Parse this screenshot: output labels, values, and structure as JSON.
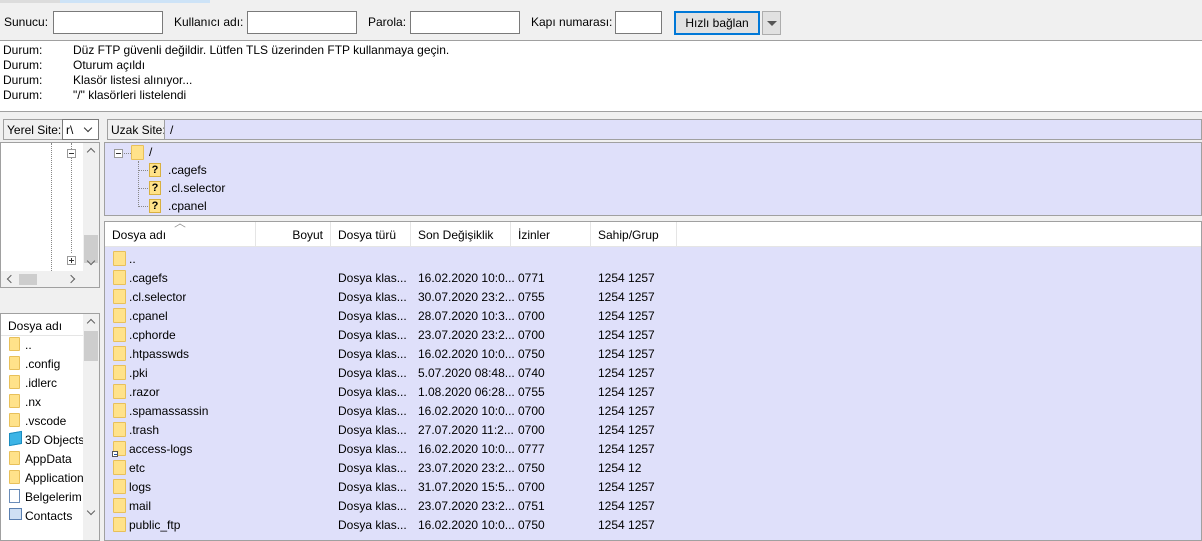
{
  "quickconnect": {
    "host_label": "Sunucu:",
    "host_value": "",
    "user_label": "Kullanıcı adı:",
    "user_value": "",
    "pass_label": "Parola:",
    "pass_value": "",
    "port_label": "Kapı numarası:",
    "port_value": "",
    "connect_label": "Hızlı bağlan"
  },
  "log": [
    {
      "key": "Durum:",
      "msg": "Düz FTP güvenli değildir. Lütfen TLS üzerinden FTP kullanmaya geçin."
    },
    {
      "key": "Durum:",
      "msg": "Oturum açıldı"
    },
    {
      "key": "Durum:",
      "msg": "Klasör listesi alınıyor..."
    },
    {
      "key": "Durum:",
      "msg": "\"/\" klasörleri listelendi"
    }
  ],
  "local": {
    "site_label": "Yerel Site:",
    "site_value": "r\\",
    "list_header": "Dosya adı",
    "items": [
      {
        "name": "..",
        "icon": "folder-icon"
      },
      {
        "name": ".config",
        "icon": "folder-icon"
      },
      {
        "name": ".idlerc",
        "icon": "folder-icon"
      },
      {
        "name": ".nx",
        "icon": "folder-icon"
      },
      {
        "name": ".vscode",
        "icon": "folder-icon"
      },
      {
        "name": "3D Objects",
        "icon": "3d-objects-icon"
      },
      {
        "name": "AppData",
        "icon": "folder-icon"
      },
      {
        "name": "Application",
        "icon": "folder-icon"
      },
      {
        "name": "Belgelerim",
        "icon": "documents-icon"
      },
      {
        "name": "Contacts",
        "icon": "contacts-icon"
      }
    ]
  },
  "remote": {
    "site_label": "Uzak Site:",
    "site_value": "/",
    "tree": {
      "root": "/",
      "children": [
        ".cagefs",
        ".cl.selector",
        ".cpanel"
      ]
    },
    "columns": [
      "Dosya adı",
      "Boyut",
      "Dosya türü",
      "Son Değişiklik",
      "İzinler",
      "Sahip/Grup"
    ],
    "rows": [
      {
        "name": "..",
        "size": "",
        "type": "",
        "modified": "",
        "perms": "",
        "owner": "",
        "icon": "folder-icon"
      },
      {
        "name": ".cagefs",
        "size": "",
        "type": "Dosya klas...",
        "modified": "16.02.2020 10:0...",
        "perms": "0771",
        "owner": "1254 1257",
        "icon": "folder-icon"
      },
      {
        "name": ".cl.selector",
        "size": "",
        "type": "Dosya klas...",
        "modified": "30.07.2020 23:2...",
        "perms": "0755",
        "owner": "1254 1257",
        "icon": "folder-icon"
      },
      {
        "name": ".cpanel",
        "size": "",
        "type": "Dosya klas...",
        "modified": "28.07.2020 10:3...",
        "perms": "0700",
        "owner": "1254 1257",
        "icon": "folder-icon"
      },
      {
        "name": ".cphorde",
        "size": "",
        "type": "Dosya klas...",
        "modified": "23.07.2020 23:2...",
        "perms": "0700",
        "owner": "1254 1257",
        "icon": "folder-icon"
      },
      {
        "name": ".htpasswds",
        "size": "",
        "type": "Dosya klas...",
        "modified": "16.02.2020 10:0...",
        "perms": "0750",
        "owner": "1254 1257",
        "icon": "folder-icon"
      },
      {
        "name": ".pki",
        "size": "",
        "type": "Dosya klas...",
        "modified": "5.07.2020 08:48...",
        "perms": "0740",
        "owner": "1254 1257",
        "icon": "folder-icon"
      },
      {
        "name": ".razor",
        "size": "",
        "type": "Dosya klas...",
        "modified": "1.08.2020 06:28...",
        "perms": "0755",
        "owner": "1254 1257",
        "icon": "folder-icon"
      },
      {
        "name": ".spamassassin",
        "size": "",
        "type": "Dosya klas...",
        "modified": "16.02.2020 10:0...",
        "perms": "0700",
        "owner": "1254 1257",
        "icon": "folder-icon"
      },
      {
        "name": ".trash",
        "size": "",
        "type": "Dosya klas...",
        "modified": "27.07.2020 11:2...",
        "perms": "0700",
        "owner": "1254 1257",
        "icon": "folder-icon"
      },
      {
        "name": "access-logs",
        "size": "",
        "type": "Dosya klas...",
        "modified": "16.02.2020 10:0...",
        "perms": "0777",
        "owner": "1254 1257",
        "icon": "folder-link-icon"
      },
      {
        "name": "etc",
        "size": "",
        "type": "Dosya klas...",
        "modified": "23.07.2020 23:2...",
        "perms": "0750",
        "owner": "1254 12",
        "icon": "folder-icon"
      },
      {
        "name": "logs",
        "size": "",
        "type": "Dosya klas...",
        "modified": "31.07.2020 15:5...",
        "perms": "0700",
        "owner": "1254 1257",
        "icon": "folder-icon"
      },
      {
        "name": "mail",
        "size": "",
        "type": "Dosya klas...",
        "modified": "23.07.2020 23:2...",
        "perms": "0751",
        "owner": "1254 1257",
        "icon": "folder-icon"
      },
      {
        "name": "public_ftp",
        "size": "",
        "type": "Dosya klas...",
        "modified": "16.02.2020 10:0...",
        "perms": "0750",
        "owner": "1254 1257",
        "icon": "folder-icon"
      }
    ]
  },
  "colors": {
    "remote_bg": "#dfe0fa",
    "folder": "#ffe28a",
    "accent": "#0078d7"
  }
}
